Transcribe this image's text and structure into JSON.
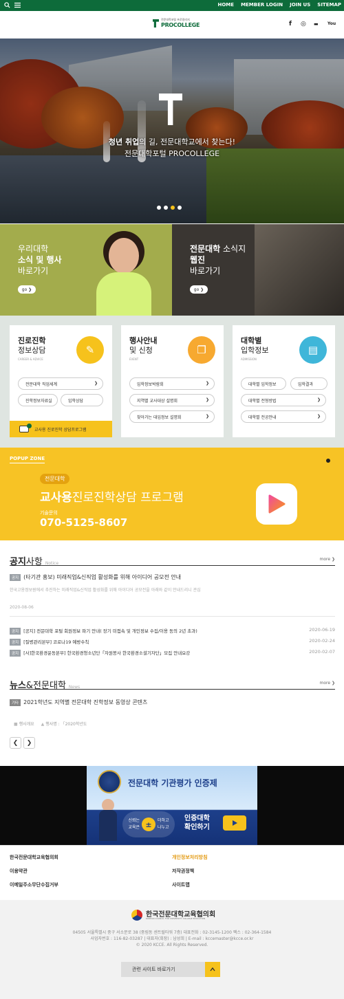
{
  "topbar": {
    "menu": [
      "HOME",
      "MEMBER LOGIN",
      "JOIN US",
      "SITEMAP"
    ]
  },
  "header": {
    "logo_small": "전문대학포털 프로칼리지",
    "logo_main": "PROCOLLEGE",
    "sns": [
      "f",
      "◎",
      "▬",
      "You"
    ]
  },
  "hero": {
    "line1_bold": "청년 취업",
    "line1_rest": "의 길, 전문대학교에서 찾는다!",
    "line2": "전문대학포털 PROCOLLEGE",
    "slides_active": 3,
    "slides_total": 4
  },
  "banners": {
    "left": {
      "line1": "우리대학",
      "line2": "소식 및 행사",
      "line3": "바로가기",
      "go": "go ❯"
    },
    "right": {
      "line1_bold": "전문대학",
      "line1_rest": " 소식지",
      "line2": "웹진",
      "line3": "바로가기",
      "go": "go ❯"
    }
  },
  "cards": [
    {
      "title_bold": "진로진학",
      "title_sub": "정보상담",
      "en": "CAREER & ADVICE",
      "color": "#f6c21c",
      "links": [
        "전문대학 직업세계",
        "진학정보자료실",
        "입학상담"
      ],
      "bottom": "교사용 진로진학 상담프로그램"
    },
    {
      "title_bold": "행사안내",
      "title_sub": "및 신청",
      "en": "EVENT",
      "color": "#f7a930",
      "links": [
        "입학정보박람회",
        "지역별 교사대상 설명회",
        "찾아가는 대입정보 설명회"
      ]
    },
    {
      "title_bold": "대학별",
      "title_sub": "입학정보",
      "en": "ADMISSION",
      "color": "#3fb6d9",
      "links": [
        "대학별 입학정보",
        "입학결과",
        "대학별 전형방법",
        "대학별 전공안내"
      ]
    }
  ],
  "popup": {
    "zone": "POPUP ZONE",
    "tag": "전문대학",
    "title_bold": "교사용",
    "title_rest": "진로진학상담 프로그램",
    "tel_label": "기술문의",
    "tel": "070-5125-8607"
  },
  "notice": {
    "title_bold": "공지",
    "title_rest": "사항",
    "en": "Notice",
    "more": "more ❯",
    "top_badge": "공지",
    "top_title": "(타기관 홍보) 미래직업&신직업 활성화를 위해 아이디어 공모전 안내",
    "top_desc": "한국고용정보원에서 추진하는 미래직업&신직업 활성화를 위해 아이디어 공모전을 아래와 같이 안내드리니 관심",
    "top_date": "2020-08-06",
    "items": [
      {
        "badge": "공지",
        "text": "[공지] 전문대학 포털 회원정보 파기 안내( 장기 미접속 및 개인정보 수집/이용 동의 2년 초과)",
        "date": "2020-06-19"
      },
      {
        "badge": "공지",
        "text": "[질병관리본부] 코로나19 예방수칙",
        "date": "2020-02-24"
      },
      {
        "badge": "공지",
        "text": "[사]한국환경운동본부] 한국환경청소년단「자원봉사 한국환경소셜기자단」모집 안내요강",
        "date": "2020-02-07"
      }
    ]
  },
  "news": {
    "title_bold": "뉴스",
    "title_rest": "&전문대학",
    "en": "News",
    "more": "more ❯",
    "badge": "기타",
    "item": "2021학년도 지역별 전문대학 진학정보 동영상 콘텐츠",
    "meta1": "행사개요",
    "meta2": "행사명 : 「2020학년도",
    "prev": "❮",
    "next": "❯"
  },
  "ad": {
    "title": "전문대학 기관평가 인증제",
    "slogan1": "신뢰는",
    "slogan2": "더하고",
    "slogan3": "교육은",
    "slogan4": "나누고",
    "cta1": "인증대학",
    "cta2": "확인하기"
  },
  "footer_nav": {
    "left": [
      "한국전문대학교육협의회",
      "이용약관",
      "이메일주소무단수집거부"
    ],
    "right": [
      "개인정보처리방침",
      "저작권정책",
      "사이트맵"
    ]
  },
  "footer": {
    "org": "한국전문대학교육협의회",
    "org_en": "KOREAN COUNCIL FOR UNIVERSITY COLLEGE EDUCATION",
    "addr": "04505 서울특별시 중구 서소문로 38 (중림동 센트럴타워 7층) 대표전화 : 02-3145-1200 팩스 : 02-364-1584",
    "biz": "사업자번호 : 116-82-03287 | 대표자(회장) : 남성희 | E-mail : kccemaster@kcce.or.kr",
    "copy": "© 2020 KCCE. All Rights Reserved.",
    "related": "관련 사이트 바로가기"
  }
}
